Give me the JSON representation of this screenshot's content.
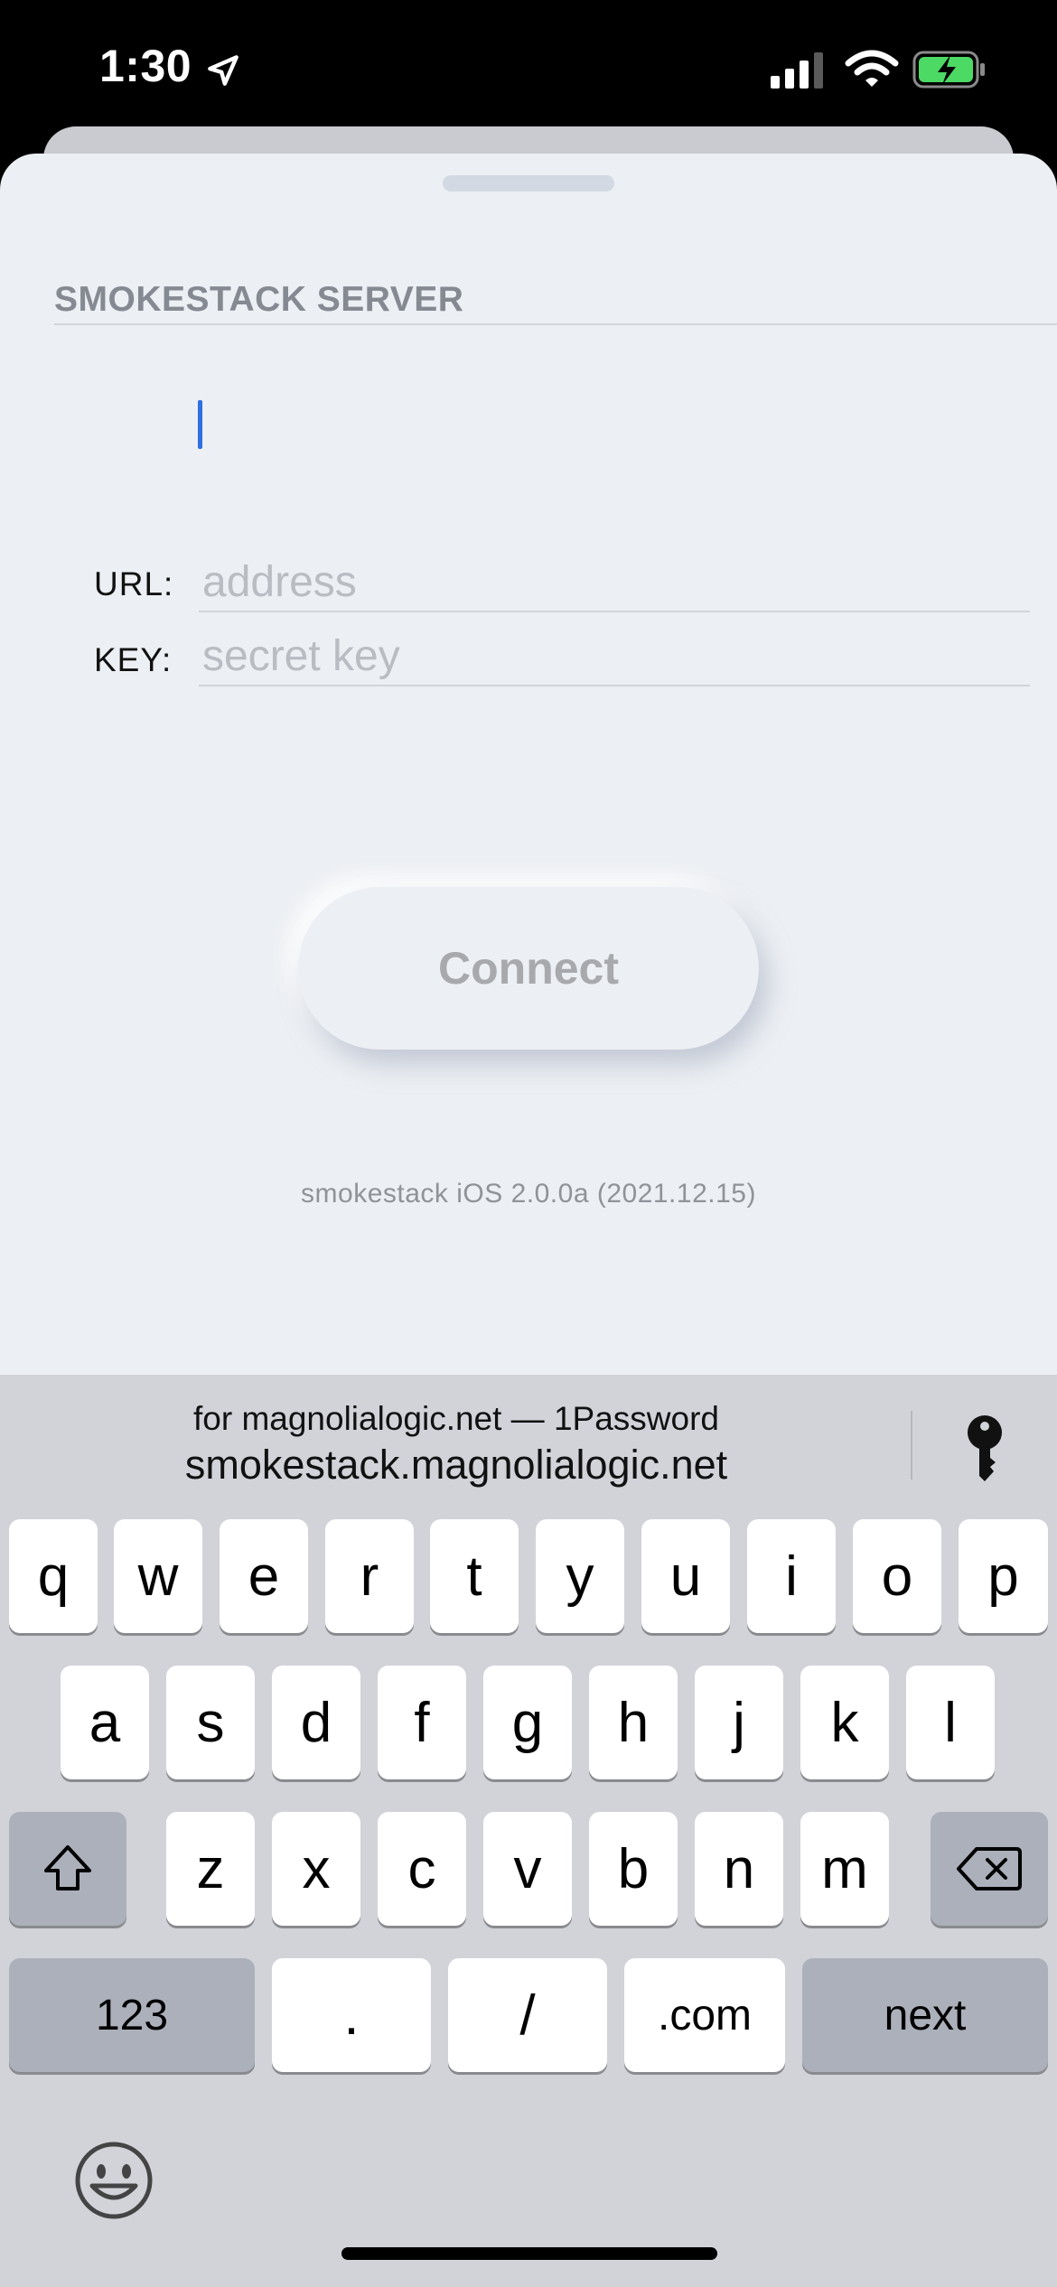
{
  "status_bar": {
    "time": "1:30"
  },
  "form": {
    "section_title": "SMOKESTACK SERVER",
    "url_label": "URL:",
    "url_placeholder": "address",
    "key_label": "KEY:",
    "key_placeholder": "secret key",
    "connect_label": "Connect",
    "version": "smokestack iOS 2.0.0a (2021.12.15)"
  },
  "quicktype": {
    "line1": "for magnolialogic.net — 1Password",
    "line2": "smokestack.magnolialogic.net"
  },
  "keyboard": {
    "row1": [
      "q",
      "w",
      "e",
      "r",
      "t",
      "y",
      "u",
      "i",
      "o",
      "p"
    ],
    "row2": [
      "a",
      "s",
      "d",
      "f",
      "g",
      "h",
      "j",
      "k",
      "l"
    ],
    "row3": [
      "z",
      "x",
      "c",
      "v",
      "b",
      "n",
      "m"
    ],
    "numbers_label": "123",
    "dot_label": ".",
    "slash_label": "/",
    "dotcom_label": ".com",
    "next_label": "next"
  },
  "colors": {
    "caret": "#2f6fe0",
    "sheet": "#eceff3",
    "keyboard": "#d1d3d9",
    "battery": "#4cd964"
  }
}
